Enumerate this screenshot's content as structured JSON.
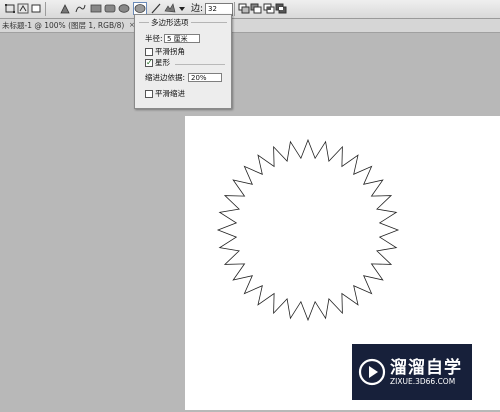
{
  "toolbar": {
    "sides_label": "边:",
    "sides_value": "32"
  },
  "document": {
    "title": "未标题-1 @ 100% (图层 1, RGB/8)",
    "close_glyph": "×"
  },
  "polygon_options": {
    "title": "多边形选项",
    "radius_label": "半径:",
    "radius_value": "5 厘米",
    "smooth_corners_label": "平滑拐角",
    "smooth_corners_checked": false,
    "star_label": "星形",
    "star_checked": true,
    "indent_label": "缩进边依据:",
    "indent_value": "20%",
    "smooth_indents_label": "平滑缩进",
    "smooth_indents_checked": false
  },
  "canvas": {
    "star_points": 32,
    "star_indent_percent": 20
  },
  "watermark": {
    "title": "溜溜自学",
    "url": "ZIXUE.3D66.COM"
  }
}
